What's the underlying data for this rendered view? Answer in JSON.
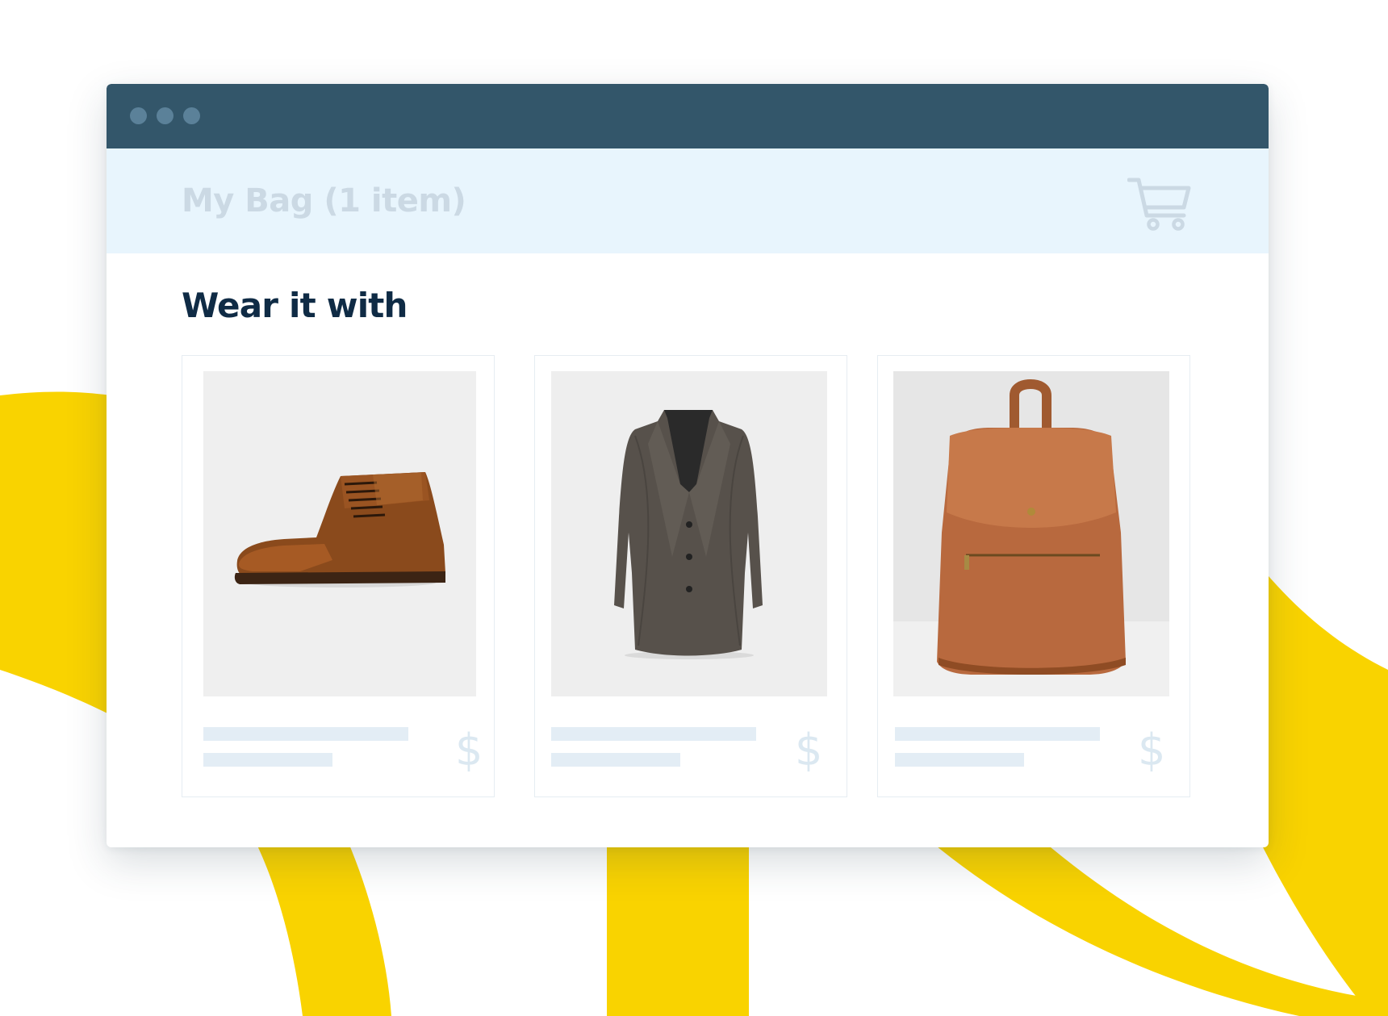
{
  "bag": {
    "title": "My Bag (1 item)",
    "cart_icon": "cart-icon"
  },
  "section": {
    "title": "Wear it with"
  },
  "products": [
    {
      "name": "brown-leather-boot",
      "price_symbol": "$"
    },
    {
      "name": "grey-tweed-coat",
      "price_symbol": "$"
    },
    {
      "name": "tan-leather-backpack",
      "price_symbol": "$"
    }
  ],
  "colors": {
    "titlebar": "#33566a",
    "header_bg": "#e8f5fd",
    "accent_yellow": "#f9d300",
    "heading": "#0f2b45"
  }
}
